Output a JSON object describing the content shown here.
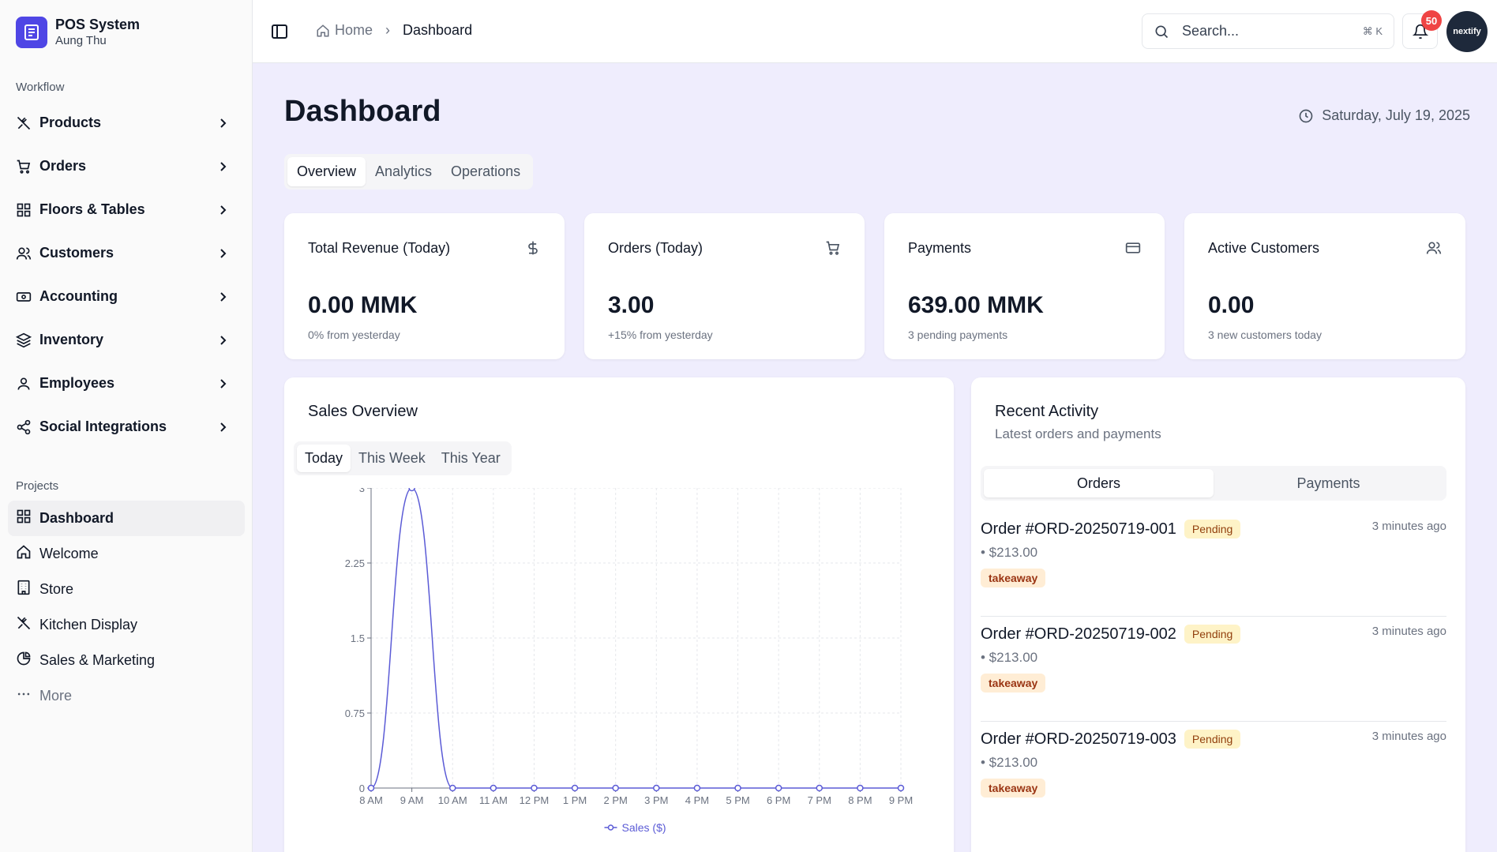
{
  "app": {
    "name": "POS System",
    "user": "Aung Thu"
  },
  "sidebar": {
    "workflow_label": "Workflow",
    "items": [
      {
        "label": "Products",
        "icon": "utensils-icon"
      },
      {
        "label": "Orders",
        "icon": "cart-icon"
      },
      {
        "label": "Floors & Tables",
        "icon": "grid-icon"
      },
      {
        "label": "Customers",
        "icon": "users-icon"
      },
      {
        "label": "Accounting",
        "icon": "banknote-icon"
      },
      {
        "label": "Inventory",
        "icon": "layers-icon"
      },
      {
        "label": "Employees",
        "icon": "user-icon"
      },
      {
        "label": "Social Integrations",
        "icon": "share-icon"
      }
    ],
    "projects_label": "Projects",
    "projects": [
      {
        "label": "Dashboard",
        "icon": "grid-icon",
        "active": true
      },
      {
        "label": "Welcome",
        "icon": "home-icon"
      },
      {
        "label": "Store",
        "icon": "building-icon"
      },
      {
        "label": "Kitchen Display",
        "icon": "utensils-icon"
      },
      {
        "label": "Sales & Marketing",
        "icon": "pie-chart-icon"
      },
      {
        "label": "More",
        "icon": "more-icon"
      }
    ]
  },
  "topbar": {
    "breadcrumb_home": "Home",
    "breadcrumb_current": "Dashboard",
    "search_placeholder": "Search...",
    "search_shortcut": "⌘ K",
    "notification_count": "50",
    "avatar_text": "nextify"
  },
  "main": {
    "title": "Dashboard",
    "date": "Saturday, July 19, 2025",
    "tabs": [
      "Overview",
      "Analytics",
      "Operations"
    ],
    "active_tab": "Overview",
    "stats": [
      {
        "title": "Total Revenue (Today)",
        "value": "0.00 MMK",
        "sub": "0% from yesterday",
        "icon": "dollar-icon"
      },
      {
        "title": "Orders (Today)",
        "value": "3.00",
        "sub": "+15% from yesterday",
        "icon": "cart-icon"
      },
      {
        "title": "Payments",
        "value": "639.00 MMK",
        "sub": "3 pending payments",
        "icon": "credit-card-icon"
      },
      {
        "title": "Active Customers",
        "value": "0.00",
        "sub": "3 new customers today",
        "icon": "users-icon"
      }
    ],
    "sales_overview": {
      "title": "Sales Overview",
      "periods": [
        "Today",
        "This Week",
        "This Year"
      ],
      "active_period": "Today"
    },
    "recent_activity": {
      "title": "Recent Activity",
      "subtitle": "Latest orders and payments",
      "tabs": [
        "Orders",
        "Payments"
      ],
      "active_tab": "Orders",
      "orders": [
        {
          "id": "Order #ORD-20250719-001",
          "status": "Pending",
          "time": "3 minutes ago",
          "amount": "• $213.00",
          "type": "takeaway"
        },
        {
          "id": "Order #ORD-20250719-002",
          "status": "Pending",
          "time": "3 minutes ago",
          "amount": "• $213.00",
          "type": "takeaway"
        },
        {
          "id": "Order #ORD-20250719-003",
          "status": "Pending",
          "time": "3 minutes ago",
          "amount": "• $213.00",
          "type": "takeaway"
        }
      ]
    }
  },
  "chart_data": {
    "type": "line",
    "x": [
      "8 AM",
      "9 AM",
      "10 AM",
      "11 AM",
      "12 PM",
      "1 PM",
      "2 PM",
      "3 PM",
      "4 PM",
      "5 PM",
      "6 PM",
      "7 PM",
      "8 PM",
      "9 PM"
    ],
    "series": [
      {
        "name": "Sales ($)",
        "values": [
          0,
          3,
          0,
          0,
          0,
          0,
          0,
          0,
          0,
          0,
          0,
          0,
          0,
          0
        ],
        "color": "#5b5bd6"
      }
    ],
    "yticks": [
      "0",
      "0.75",
      "1.5",
      "2.25",
      "3"
    ],
    "ylim": [
      0,
      3
    ],
    "grid": true,
    "legend": "bottom"
  }
}
